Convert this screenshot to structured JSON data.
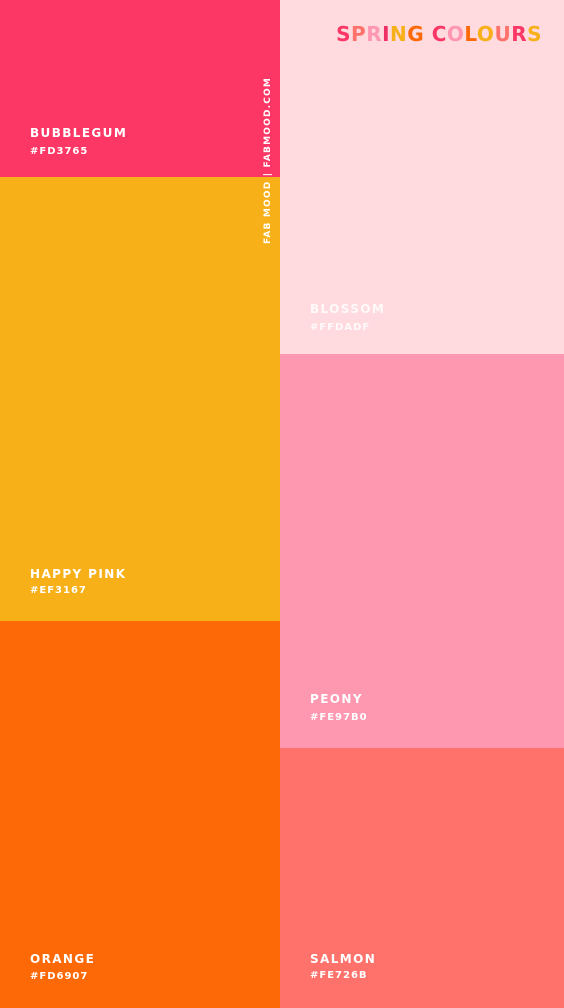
{
  "title": {
    "text": "SPRING COLOURS",
    "letter_colors": [
      "#FD3765",
      "#FE726B",
      "#FE97B0",
      "#EF3167",
      "#F7B018",
      "#FD6907",
      "#FD3765",
      "#FE97B0",
      "#FD6907",
      "#F7B018",
      "#FE726B",
      "#FD3765",
      "#F7B018",
      "#FE97B0"
    ]
  },
  "brand": "FAB MOOD | FABMOOD.COM",
  "swatches": [
    {
      "name": "BUBBLEGUM",
      "hex": "#FD3765",
      "color": "#FD3765"
    },
    {
      "name": "HAPPY PINK",
      "hex": "#EF3167",
      "color": "#F7B018"
    },
    {
      "name": "ORANGE",
      "hex": "#FD6907",
      "color": "#FD6907"
    },
    {
      "name": "BLOSSOM",
      "hex": "#FFDADF",
      "color": "#FFDADF"
    },
    {
      "name": "PEONY",
      "hex": "#FE97B0",
      "color": "#FE97B0"
    },
    {
      "name": "SALMON",
      "hex": "#FE726B",
      "color": "#FE726B"
    }
  ]
}
